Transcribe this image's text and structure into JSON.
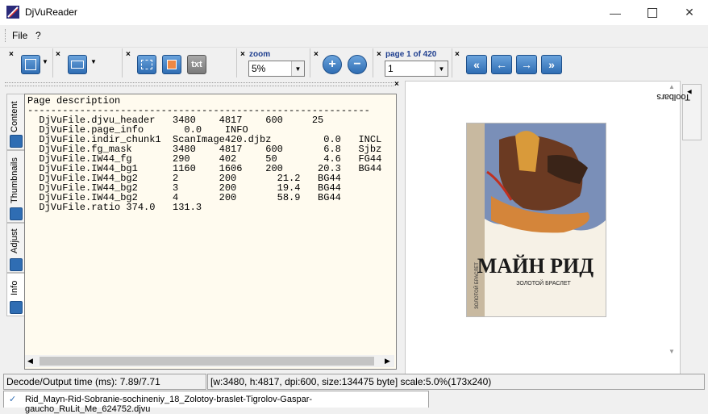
{
  "window": {
    "title": "DjVuReader"
  },
  "menu": {
    "file": "File",
    "help": "?"
  },
  "toolbar": {
    "zoom_label": "zoom",
    "zoom_value": "5%",
    "page_label": "page 1 of 420",
    "page_value": "1",
    "txt_label": "txt"
  },
  "side_tabs": [
    "Content",
    "Thumbnails",
    "Adjust",
    "Info"
  ],
  "right_tab": "Toolbars",
  "page_description": {
    "header": "Page description",
    "separator": "-----------------------------------------------------------",
    "lines": [
      "  DjVuFile.djvu_header   3480    4817    600     25",
      "  DjVuFile.page_info       0.0    INFO",
      "  DjVuFile.indir_chunk1  ScanImage420.djbz         0.0   INCL",
      "  DjVuFile.fg_mask       3480    4817    600       6.8   Sjbz",
      "  DjVuFile.IW44_fg       290     402     50        4.6   FG44",
      "  DjVuFile.IW44_bg1      1160    1606    200      20.3   BG44",
      "  DjVuFile.IW44_bg2      2       200       21.2   BG44",
      "  DjVuFile.IW44_bg2      3       200       19.4   BG44",
      "  DjVuFile.IW44_bg2      4       200       58.9   BG44",
      "  DjVuFile.ratio 374.0   131.3"
    ]
  },
  "book": {
    "author": "МАЙН РИД",
    "title": "ЗОЛОТОЙ БРАСЛЕТ",
    "spine": "ЗОЛОТОЙ БРАСЛЕТ"
  },
  "status": {
    "decode": "Decode/Output time (ms): 7.89/7.71",
    "info": "[w:3480, h:4817, dpi:600, size:134475 byte] scale:5.0%(173x240)"
  },
  "file_tab": "Rid_Mayn-Rid-Sobranie-sochineniy_18_Zolotoy-braslet-Tigrolov-Gaspar-gaucho_RuLit_Me_624752.djvu"
}
